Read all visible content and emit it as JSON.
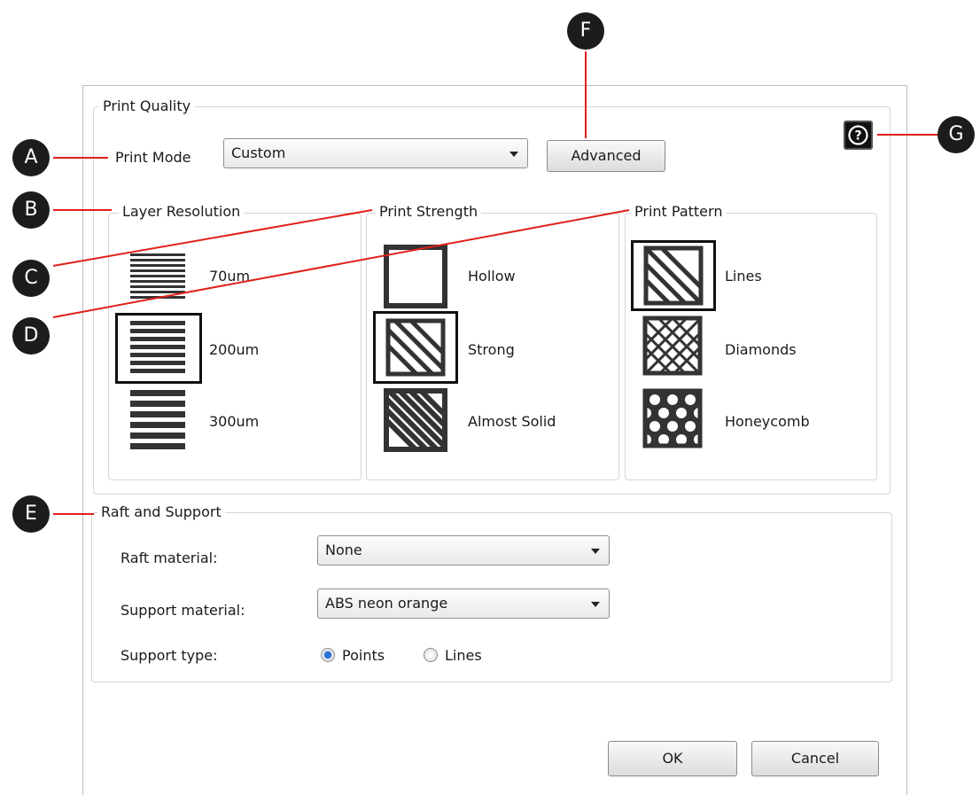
{
  "print_quality": {
    "title": "Print Quality",
    "print_mode_label": "Print Mode",
    "print_mode_value": "Custom",
    "advanced_button": "Advanced",
    "help_icon": "question-mark-icon"
  },
  "layer_resolution": {
    "title": "Layer Resolution",
    "options": [
      "70um",
      "200um",
      "300um"
    ],
    "selected": "200um"
  },
  "print_strength": {
    "title": "Print Strength",
    "options": [
      "Hollow",
      "Strong",
      "Almost Solid"
    ],
    "selected": "Strong"
  },
  "print_pattern": {
    "title": "Print Pattern",
    "options": [
      "Lines",
      "Diamonds",
      "Honeycomb"
    ],
    "selected": "Lines"
  },
  "raft_support": {
    "title": "Raft and Support",
    "raft_label": "Raft material:",
    "raft_value": "None",
    "support_label": "Support material:",
    "support_value": "ABS neon orange",
    "support_type_label": "Support type:",
    "support_type_options": [
      "Points",
      "Lines"
    ],
    "support_type_selected": "Points"
  },
  "footer": {
    "ok": "OK",
    "cancel": "Cancel"
  },
  "callouts": [
    "A",
    "B",
    "C",
    "D",
    "E",
    "F",
    "G"
  ],
  "colors": {
    "callout_bg": "#1c1c1c",
    "callout_line": "#e0201a",
    "radio_selected": "#2a6fd6"
  }
}
